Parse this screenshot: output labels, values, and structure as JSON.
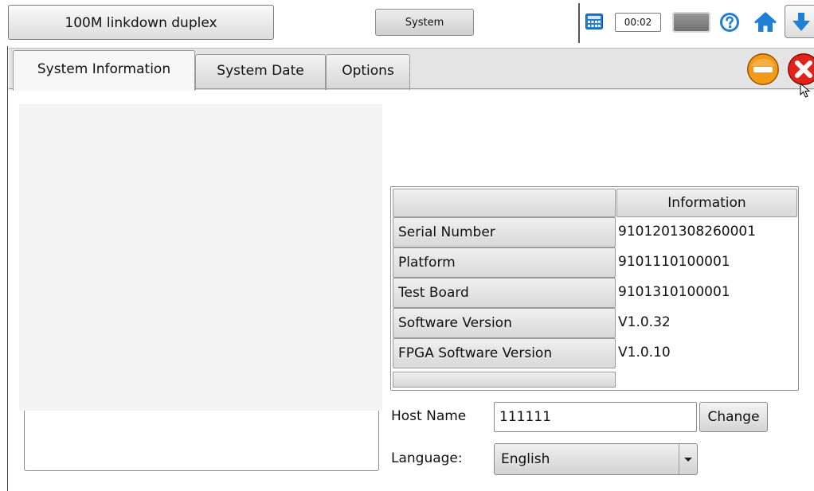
{
  "topbar": {
    "status_text": "100M linkdown duplex",
    "system_button": "System",
    "timer": "00:02",
    "icons": [
      "calculator-icon",
      "battery-icon",
      "help-icon",
      "home-icon",
      "arrow-down-icon"
    ]
  },
  "tabs": [
    {
      "label": "System Information",
      "active": true
    },
    {
      "label": "System Date",
      "active": false
    },
    {
      "label": "Options",
      "active": false
    }
  ],
  "info_table": {
    "header": "Information",
    "rows": [
      {
        "label": "Serial Number",
        "value": "9101201308260001"
      },
      {
        "label": "Platform",
        "value": "9101110100001"
      },
      {
        "label": "Test Board",
        "value": "9101310100001"
      },
      {
        "label": "Software Version",
        "value": "V1.0.32"
      },
      {
        "label": "FPGA Software Version",
        "value": "V1.0.10"
      }
    ]
  },
  "host": {
    "label": "Host Name",
    "value": "111111",
    "button": "Change"
  },
  "language": {
    "label": "Language:",
    "value": "English"
  },
  "colors": {
    "accent_blue": "#1e7fd6",
    "minimize_orange": "#f39a1a",
    "close_red": "#e2231a"
  }
}
